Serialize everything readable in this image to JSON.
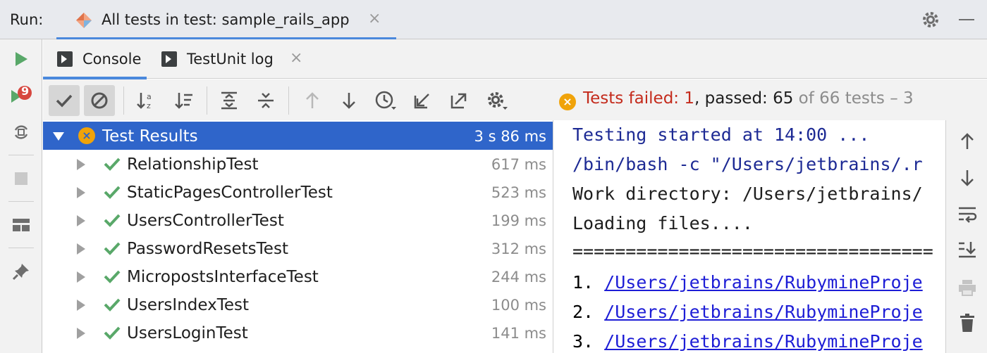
{
  "run_bar": {
    "label": "Run:",
    "tab_title": "All tests in test: sample_rails_app",
    "tab_close": "×"
  },
  "left_toolbar": {
    "rerun_failed_badge": "9"
  },
  "sub_tabs": [
    {
      "label": "Console",
      "active": true
    },
    {
      "label": "TestUnit log",
      "active": false,
      "close": "×"
    }
  ],
  "status": {
    "failed_text": "Tests failed: 1",
    "passed_text": ", passed: 65",
    "total_text": " of 66 tests – 3"
  },
  "tree": {
    "root": {
      "name": "Test Results",
      "time": "3 s 86 ms"
    },
    "rows": [
      {
        "name": "RelationshipTest",
        "time": "617 ms"
      },
      {
        "name": "StaticPagesControllerTest",
        "time": "523 ms"
      },
      {
        "name": "UsersControllerTest",
        "time": "199 ms"
      },
      {
        "name": "PasswordResetsTest",
        "time": "312 ms"
      },
      {
        "name": "MicropostsInterfaceTest",
        "time": "244 ms"
      },
      {
        "name": "UsersIndexTest",
        "time": "100 ms"
      },
      {
        "name": "UsersLoginTest",
        "time": "141 ms"
      }
    ]
  },
  "console": {
    "lines": [
      "Testing started at 14:00 ...",
      "/bin/bash -c \"/Users/jetbrains/.r",
      "Work directory: /Users/jetbrains/",
      "Loading files....",
      "=================================="
    ],
    "links": [
      {
        "num": "1.",
        "text": "/Users/jetbrains/RubymineProje"
      },
      {
        "num": "2.",
        "text": "/Users/jetbrains/RubymineProje"
      },
      {
        "num": "3.",
        "text": "/Users/jetbrains/RubymineProje"
      }
    ]
  },
  "colors": {
    "accent": "#4a88dc",
    "selection": "#2f65ca",
    "pass_green": "#59a869",
    "fail_orange": "#f0a30a",
    "fail_red": "#c42b1c"
  }
}
